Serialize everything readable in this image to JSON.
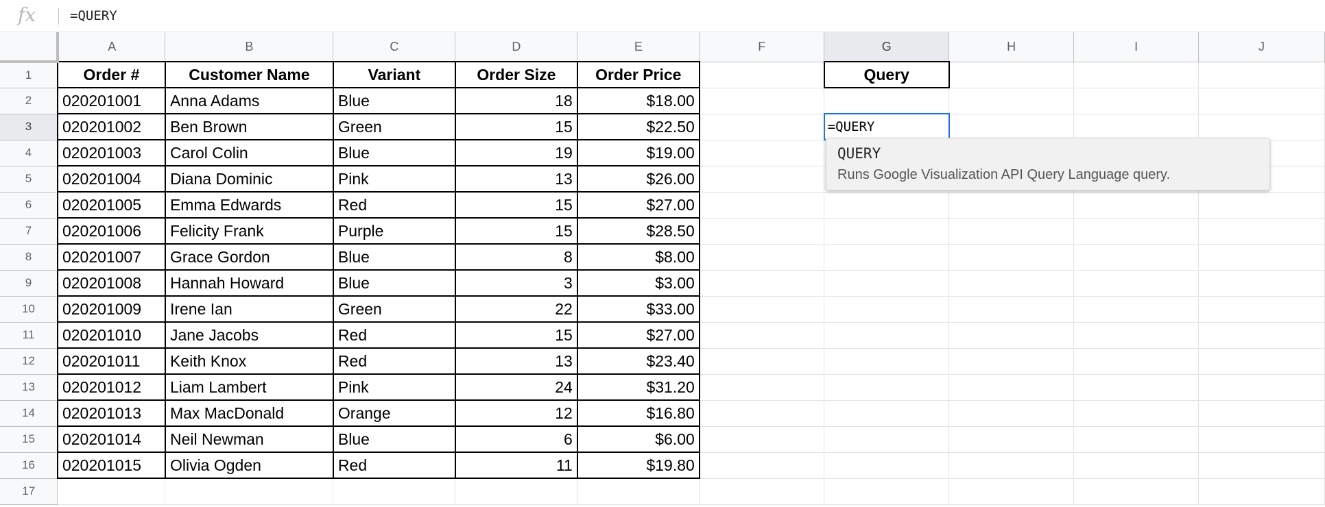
{
  "formula_bar": {
    "icon": "fx-icon",
    "value": "=QUERY"
  },
  "columns": [
    "A",
    "B",
    "C",
    "D",
    "E",
    "F",
    "G",
    "H",
    "I",
    "J"
  ],
  "selected_column": "G",
  "selected_row": 3,
  "headers": {
    "order_num": "Order #",
    "customer": "Customer Name",
    "variant": "Variant",
    "size": "Order Size",
    "price": "Order Price",
    "query": "Query"
  },
  "rows": [
    {
      "row": "2",
      "order": "020201001",
      "name": "Anna Adams",
      "variant": "Blue",
      "size": "18",
      "price": "$18.00"
    },
    {
      "row": "3",
      "order": "020201002",
      "name": "Ben Brown",
      "variant": "Green",
      "size": "15",
      "price": "$22.50"
    },
    {
      "row": "4",
      "order": "020201003",
      "name": "Carol Colin",
      "variant": "Blue",
      "size": "19",
      "price": "$19.00"
    },
    {
      "row": "5",
      "order": "020201004",
      "name": "Diana Dominic",
      "variant": "Pink",
      "size": "13",
      "price": "$26.00"
    },
    {
      "row": "6",
      "order": "020201005",
      "name": "Emma Edwards",
      "variant": "Red",
      "size": "15",
      "price": "$27.00"
    },
    {
      "row": "7",
      "order": "020201006",
      "name": "Felicity Frank",
      "variant": "Purple",
      "size": "15",
      "price": "$28.50"
    },
    {
      "row": "8",
      "order": "020201007",
      "name": "Grace Gordon",
      "variant": "Blue",
      "size": "8",
      "price": "$8.00"
    },
    {
      "row": "9",
      "order": "020201008",
      "name": "Hannah Howard",
      "variant": "Blue",
      "size": "3",
      "price": "$3.00"
    },
    {
      "row": "10",
      "order": "020201009",
      "name": "Irene Ian",
      "variant": "Green",
      "size": "22",
      "price": "$33.00"
    },
    {
      "row": "11",
      "order": "020201010",
      "name": "Jane Jacobs",
      "variant": "Red",
      "size": "15",
      "price": "$27.00"
    },
    {
      "row": "12",
      "order": "020201011",
      "name": "Keith Knox",
      "variant": "Red",
      "size": "13",
      "price": "$23.40"
    },
    {
      "row": "13",
      "order": "020201012",
      "name": "Liam Lambert",
      "variant": "Pink",
      "size": "24",
      "price": "$31.20"
    },
    {
      "row": "14",
      "order": "020201013",
      "name": "Max MacDonald",
      "variant": "Orange",
      "size": "12",
      "price": "$16.80"
    },
    {
      "row": "15",
      "order": "020201014",
      "name": "Neil Newman",
      "variant": "Blue",
      "size": "6",
      "price": "$6.00"
    },
    {
      "row": "16",
      "order": "020201015",
      "name": "Olivia Ogden",
      "variant": "Red",
      "size": "11",
      "price": "$19.80"
    }
  ],
  "row_numbers": [
    "1",
    "2",
    "3",
    "4",
    "5",
    "6",
    "7",
    "8",
    "9",
    "10",
    "11",
    "12",
    "13",
    "14",
    "15",
    "16",
    "17"
  ],
  "active_cell": {
    "ref": "G3",
    "value": "=QUERY"
  },
  "autocomplete": {
    "function_name": "QUERY",
    "description": "Runs Google Visualization API Query Language query."
  },
  "colors": {
    "active_border": "#1a73e8",
    "header_bg": "#f8f9fa",
    "selected_header_bg": "#e8eaed",
    "gridline": "#e2e3e3"
  }
}
